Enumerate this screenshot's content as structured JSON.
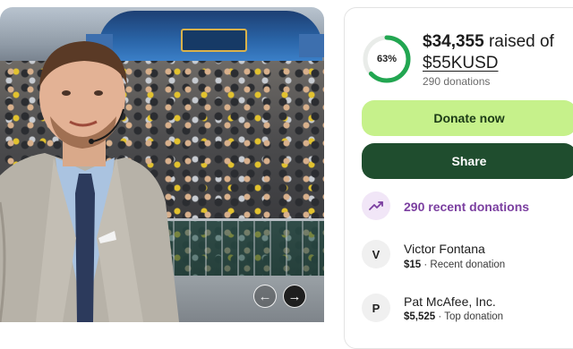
{
  "progress": {
    "percent": 63,
    "percent_label": "63%",
    "color": "#22a651"
  },
  "raised": {
    "amount": "$34,355",
    "suffix": " raised of",
    "goal": "$55KUSD",
    "donations": "290 donations"
  },
  "actions": {
    "donate_label": "Donate now",
    "share_label": "Share"
  },
  "recent": {
    "label": "290 recent donations",
    "icon": "trending-up-icon"
  },
  "donors": [
    {
      "initial": "V",
      "name": "Victor Fontana",
      "amount": "$15",
      "note": " · Recent donation"
    },
    {
      "initial": "P",
      "name": "Pat McAfee, Inc.",
      "amount": "$5,525",
      "note": " · Top donation"
    }
  ],
  "carousel": {
    "prev_icon": "chevron-left-icon",
    "next_icon": "chevron-right-icon"
  },
  "colors": {
    "donate_bg": "#c6f18b",
    "share_bg": "#1f4d2e",
    "accent_purple": "#7b3fa0"
  }
}
